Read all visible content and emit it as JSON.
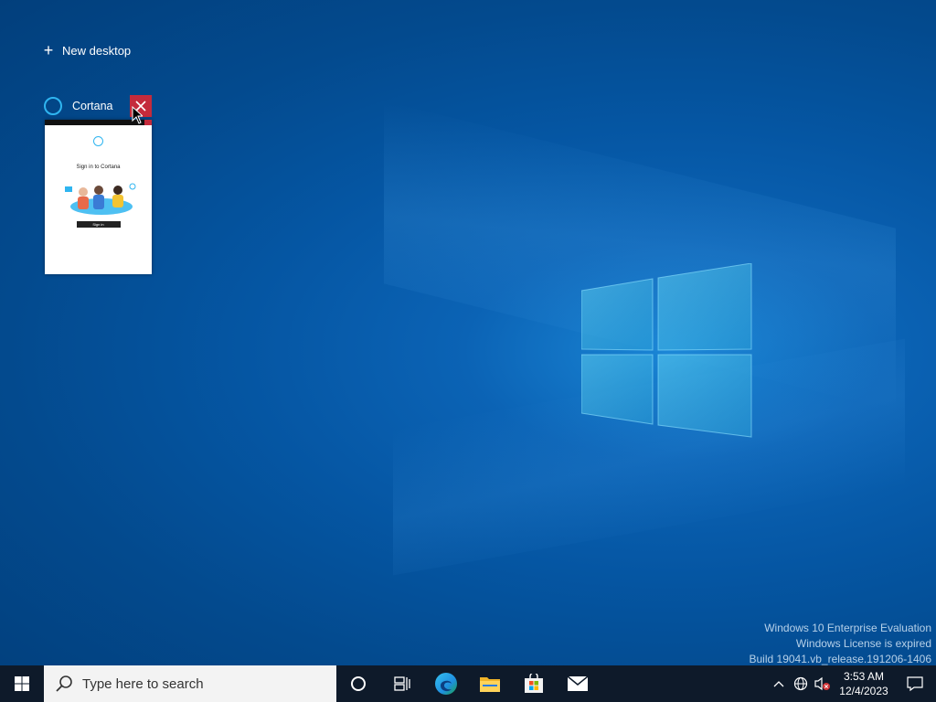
{
  "task_view": {
    "new_desktop_label": "New desktop",
    "windows": [
      {
        "title": "Cortana",
        "thumbnail": {
          "heading": "Sign in to Cortana",
          "button_label": "Sign in"
        }
      }
    ]
  },
  "watermark": {
    "line1": "Windows 10 Enterprise Evaluation",
    "line2": "Windows License is expired",
    "line3": "Build 19041.vb_release.191206-1406"
  },
  "taskbar": {
    "search_placeholder": "Type here to search",
    "pinned_apps": [
      "edge-icon",
      "file-explorer-icon",
      "microsoft-store-icon",
      "mail-icon"
    ],
    "clock": {
      "time": "3:53 AM",
      "date": "12/4/2023"
    }
  },
  "colors": {
    "taskbar_bg": "#0e1a2a",
    "close_red": "#c42b3c",
    "cortana_blue": "#2fb5f0",
    "desktop_blue": "#0556a3"
  }
}
